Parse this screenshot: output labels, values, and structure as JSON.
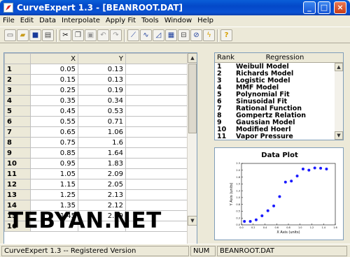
{
  "window": {
    "title": "CurveExpert 1.3 - [BEANROOT.DAT]"
  },
  "menu": [
    "File",
    "Edit",
    "Data",
    "Interpolate",
    "Apply Fit",
    "Tools",
    "Window",
    "Help"
  ],
  "toolbar": {
    "buttons": [
      "new-icon",
      "open-icon",
      "save-icon",
      "print-icon",
      "cut-icon",
      "copy-icon",
      "paste-icon",
      "undo-icon",
      "redo-icon",
      "linear-chart-icon",
      "curve-chart-icon",
      "quadratic-chart-icon",
      "multi-chart-icon",
      "sort-icon",
      "find-fit-icon",
      "lightning-icon",
      "help-icon"
    ]
  },
  "grid": {
    "columns": [
      "X",
      "Y"
    ],
    "rows": [
      {
        "n": "1",
        "x": "0.05",
        "y": "0.13"
      },
      {
        "n": "2",
        "x": "0.15",
        "y": "0.13"
      },
      {
        "n": "3",
        "x": "0.25",
        "y": "0.19"
      },
      {
        "n": "4",
        "x": "0.35",
        "y": "0.34"
      },
      {
        "n": "5",
        "x": "0.45",
        "y": "0.53"
      },
      {
        "n": "6",
        "x": "0.55",
        "y": "0.71"
      },
      {
        "n": "7",
        "x": "0.65",
        "y": "1.06"
      },
      {
        "n": "8",
        "x": "0.75",
        "y": "1.6"
      },
      {
        "n": "9",
        "x": "0.85",
        "y": "1.64"
      },
      {
        "n": "10",
        "x": "0.95",
        "y": "1.83"
      },
      {
        "n": "11",
        "x": "1.05",
        "y": "2.09"
      },
      {
        "n": "12",
        "x": "1.15",
        "y": "2.05"
      },
      {
        "n": "13",
        "x": "1.25",
        "y": "2.13"
      },
      {
        "n": "14",
        "x": "1.35",
        "y": "2.12"
      },
      {
        "n": "15",
        "x": "1.45",
        "y": "2.09"
      },
      {
        "n": "16",
        "x": "",
        "y": ""
      }
    ]
  },
  "watermark": "TEBYAN.NET",
  "regression": {
    "header_rank": "Rank",
    "header_name": "Regression",
    "items": [
      {
        "rank": "1",
        "name": "Weibull Model"
      },
      {
        "rank": "2",
        "name": "Richards Model"
      },
      {
        "rank": "3",
        "name": "Logistic Model"
      },
      {
        "rank": "4",
        "name": "MMF Model"
      },
      {
        "rank": "5",
        "name": "Polynomial Fit"
      },
      {
        "rank": "6",
        "name": "Sinusoidal Fit"
      },
      {
        "rank": "7",
        "name": "Rational Function"
      },
      {
        "rank": "8",
        "name": "Gompertz Relation"
      },
      {
        "rank": "9",
        "name": "Gaussian Model"
      },
      {
        "rank": "10",
        "name": "Modified Hoerl"
      },
      {
        "rank": "11",
        "name": "Vapor Pressure"
      }
    ]
  },
  "plot": {
    "title": "Data Plot",
    "xlabel": "X Axis (units)",
    "ylabel": "Y Axis (units)",
    "point_color": "#1a1aff"
  },
  "chart_data": {
    "type": "scatter",
    "title": "Data Plot",
    "xlabel": "X Axis (units)",
    "ylabel": "Y Axis (units)",
    "x": [
      0.05,
      0.15,
      0.25,
      0.35,
      0.45,
      0.55,
      0.65,
      0.75,
      0.85,
      0.95,
      1.05,
      1.15,
      1.25,
      1.35,
      1.45
    ],
    "y": [
      0.13,
      0.13,
      0.19,
      0.34,
      0.53,
      0.71,
      1.06,
      1.6,
      1.64,
      1.83,
      2.09,
      2.05,
      2.13,
      2.12,
      2.09
    ],
    "xlim": [
      0.0,
      1.6
    ],
    "ylim": [
      0.0,
      2.3
    ],
    "xticks": [
      "0.0",
      "0.2",
      "0.4",
      "0.6",
      "0.8",
      "1.0",
      "1.2",
      "1.4",
      "1.6"
    ],
    "yticks": [
      "0.0",
      "0.3",
      "0.5",
      "0.8",
      "1.0",
      "1.3",
      "1.5",
      "1.8",
      "2.0",
      "2.3"
    ],
    "grid": false
  },
  "status": {
    "message": "CurveExpert 1.3 -- Registered Version",
    "num": "NUM",
    "file": "BEANROOT.DAT"
  }
}
